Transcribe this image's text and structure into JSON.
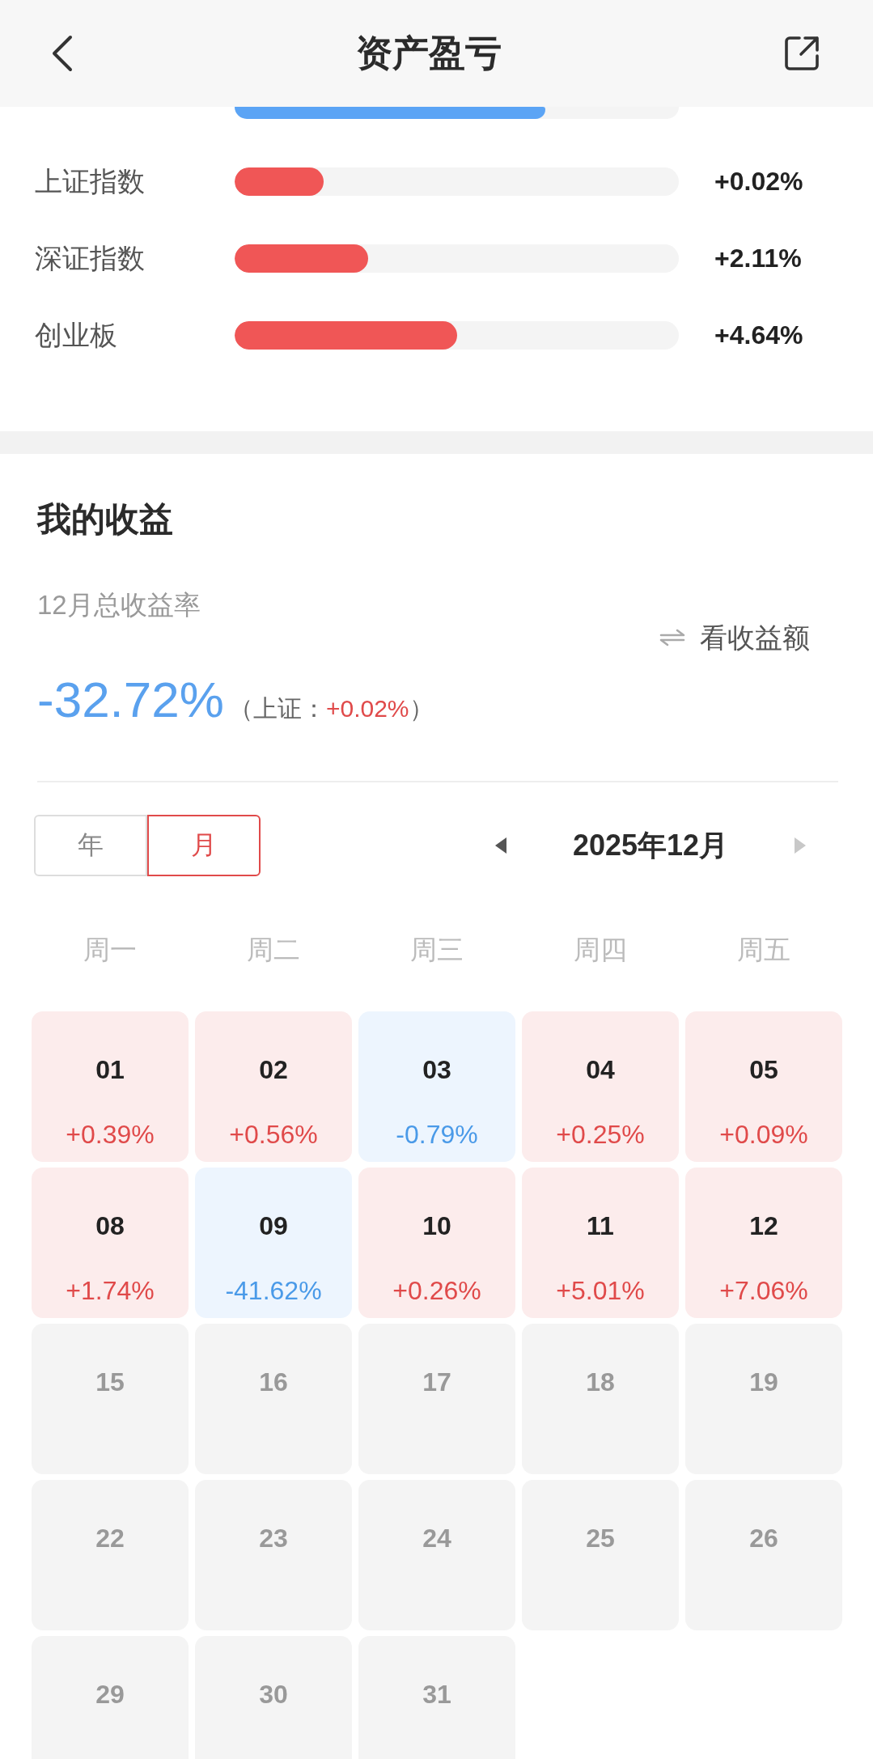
{
  "header": {
    "title": "资产盈亏"
  },
  "benchmarks": [
    {
      "kind": "clipped",
      "level": 0.7,
      "color": "#5ba4f5"
    },
    {
      "kind": "full",
      "label": "上证指数",
      "level": 0.2,
      "color": "#f05656",
      "value": "+0.02%"
    },
    {
      "kind": "full",
      "label": "深证指数",
      "level": 0.3,
      "color": "#f05656",
      "value": "+2.11%"
    },
    {
      "kind": "full",
      "label": "创业板",
      "level": 0.5,
      "color": "#f05656",
      "value": "+4.64%"
    }
  ],
  "earnings": {
    "title": "我的收益",
    "period_label": "12月总收益率",
    "total": "-32.72%",
    "total_loss": true,
    "benchmark_prefix": "（上证：",
    "benchmark_value": "+0.02%",
    "benchmark_loss": false,
    "benchmark_suffix": "）",
    "switch_label": "看收益额"
  },
  "period_tabs": [
    {
      "label": "年",
      "selected": false
    },
    {
      "label": "月",
      "selected": true
    }
  ],
  "month_nav": {
    "label": "2025年12月",
    "prev_disabled": false,
    "next_disabled": true
  },
  "weekdays": [
    "周一",
    "周二",
    "周三",
    "周四",
    "周五"
  ],
  "days": [
    {
      "day": "01",
      "change": "+0.39%",
      "kind": "gain"
    },
    {
      "day": "02",
      "change": "+0.56%",
      "kind": "gain"
    },
    {
      "day": "03",
      "change": "-0.79%",
      "kind": "loss"
    },
    {
      "day": "04",
      "change": "+0.25%",
      "kind": "gain"
    },
    {
      "day": "05",
      "change": "+0.09%",
      "kind": "gain"
    },
    {
      "day": "08",
      "change": "+1.74%",
      "kind": "gain"
    },
    {
      "day": "09",
      "change": "-41.62%",
      "kind": "loss"
    },
    {
      "day": "10",
      "change": "+0.26%",
      "kind": "gain"
    },
    {
      "day": "11",
      "change": "+5.01%",
      "kind": "gain"
    },
    {
      "day": "12",
      "change": "+7.06%",
      "kind": "gain"
    },
    {
      "day": "15",
      "kind": "empty"
    },
    {
      "day": "16",
      "kind": "empty"
    },
    {
      "day": "17",
      "kind": "empty"
    },
    {
      "day": "18",
      "kind": "empty"
    },
    {
      "day": "19",
      "kind": "empty"
    },
    {
      "day": "22",
      "kind": "empty"
    },
    {
      "day": "23",
      "kind": "empty"
    },
    {
      "day": "24",
      "kind": "empty"
    },
    {
      "day": "25",
      "kind": "empty"
    },
    {
      "day": "26",
      "kind": "empty"
    },
    {
      "day": "29",
      "kind": "empty"
    },
    {
      "day": "30",
      "kind": "empty"
    },
    {
      "day": "31",
      "kind": "empty"
    }
  ]
}
